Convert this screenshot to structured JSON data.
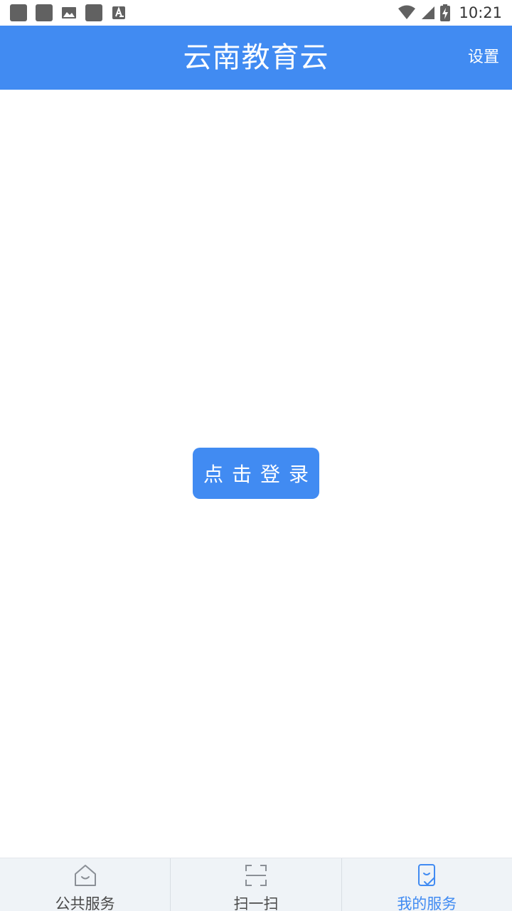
{
  "status_bar": {
    "time": "10:21",
    "left_icons": [
      "notification-square-icon",
      "notification-square-icon",
      "image-icon",
      "notification-square-icon",
      "text-a-icon"
    ],
    "right_icons": [
      "wifi-icon",
      "cellular-signal-icon",
      "battery-charging-icon"
    ]
  },
  "header": {
    "title": "云南教育云",
    "settings_label": "设置",
    "background_color": "#418bf2"
  },
  "main": {
    "login_label": "点击登录",
    "accent_color": "#418bf2"
  },
  "tabs": [
    {
      "label": "公共服务",
      "icon": "home-icon",
      "active": false
    },
    {
      "label": "扫一扫",
      "icon": "scan-icon",
      "active": false
    },
    {
      "label": "我的服务",
      "icon": "my-service-icon",
      "active": true
    }
  ]
}
